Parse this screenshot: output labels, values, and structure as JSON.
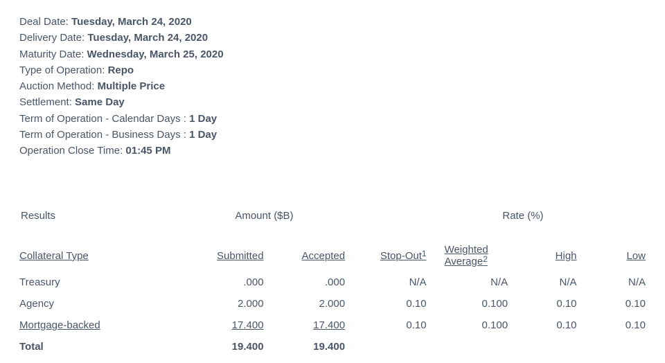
{
  "details": {
    "deal_date_label": "Deal Date: ",
    "deal_date_value": "Tuesday, March 24, 2020",
    "delivery_date_label": "Delivery Date: ",
    "delivery_date_value": "Tuesday, March 24, 2020",
    "maturity_date_label": "Maturity Date: ",
    "maturity_date_value": "Wednesday, March 25, 2020",
    "operation_type_label": "Type of Operation: ",
    "operation_type_value": "Repo",
    "auction_method_label": "Auction Method: ",
    "auction_method_value": "Multiple Price",
    "settlement_label": "Settlement: ",
    "settlement_value": "Same Day",
    "term_calendar_label": "Term of Operation - Calendar Days : ",
    "term_calendar_value": "1 Day",
    "term_business_label": "Term of Operation - Business Days : ",
    "term_business_value": "1 Day",
    "close_time_label": "Operation Close Time: ",
    "close_time_value": "01:45 PM"
  },
  "sections": {
    "results": "Results",
    "amount": "Amount ($B)",
    "rate": "Rate (%)"
  },
  "columns": {
    "collateral_type": "Collateral Type",
    "submitted": "Submitted",
    "accepted": "Accepted",
    "stop_out": "Stop-Out",
    "stop_out_fn": "1",
    "weighted_avg_line1": "Weighted",
    "weighted_avg_line2": "Average",
    "weighted_avg_fn": "2",
    "high": "High",
    "low": "Low"
  },
  "rows": [
    {
      "collateral_type": "Treasury",
      "submitted": ".000",
      "accepted": ".000",
      "stop_out": "N/A",
      "weighted_avg": "N/A",
      "high": "N/A",
      "low": "N/A",
      "underline_ct": false,
      "underline_amt": false
    },
    {
      "collateral_type": "Agency",
      "submitted": "2.000",
      "accepted": "2.000",
      "stop_out": "0.10",
      "weighted_avg": "0.100",
      "high": "0.10",
      "low": "0.10",
      "underline_ct": false,
      "underline_amt": false
    },
    {
      "collateral_type": "Mortgage-backed",
      "submitted": "17.400",
      "accepted": "17.400",
      "stop_out": "0.10",
      "weighted_avg": "0.100",
      "high": "0.10",
      "low": "0.10",
      "underline_ct": true,
      "underline_amt": true
    }
  ],
  "total": {
    "label": "Total",
    "submitted": "19.400",
    "accepted": "19.400"
  }
}
